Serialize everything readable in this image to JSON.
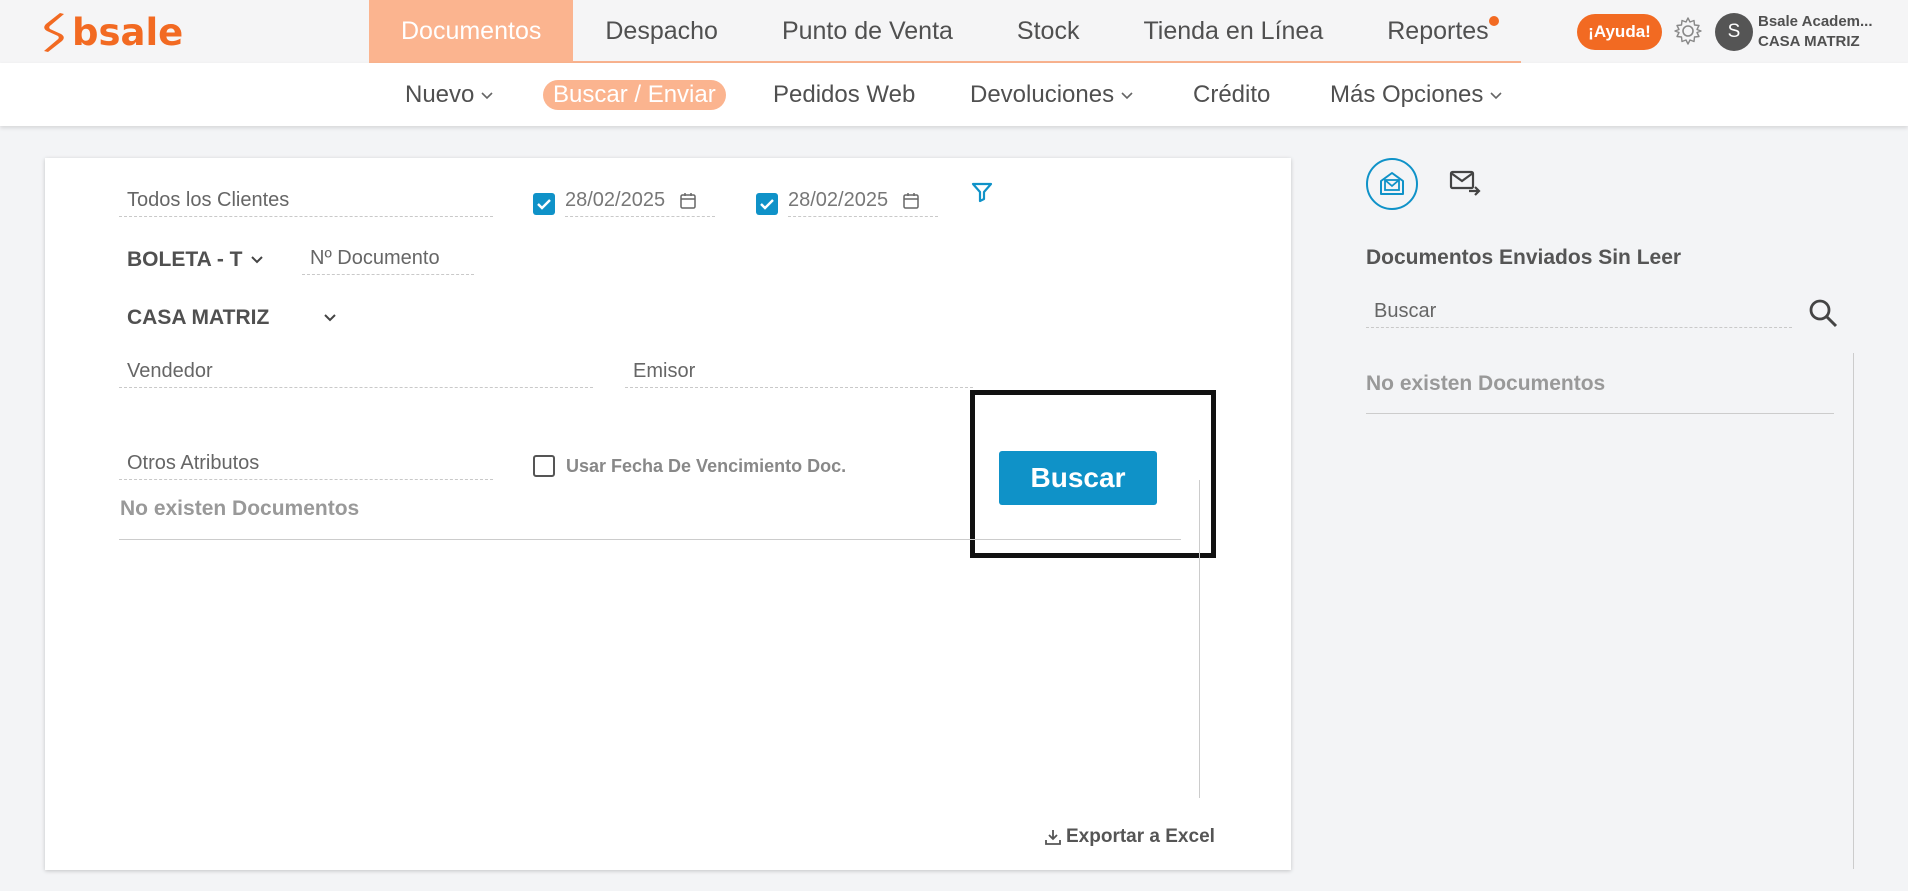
{
  "brand": {
    "name": "bsale",
    "color": "#f26a22"
  },
  "main_nav": [
    {
      "label": "Documentos",
      "active": true
    },
    {
      "label": "Despacho",
      "active": false
    },
    {
      "label": "Punto de Venta",
      "active": false
    },
    {
      "label": "Stock",
      "active": false
    },
    {
      "label": "Tienda en Línea",
      "active": false
    },
    {
      "label": "Reportes",
      "active": false,
      "notification_dot": true
    }
  ],
  "header": {
    "help_label": "¡Ayuda!",
    "avatar_initial": "S",
    "user_name": "Bsale Academ...",
    "user_branch": "CASA MATRIZ"
  },
  "sub_nav": {
    "nuevo": "Nuevo",
    "buscar_enviar": "Buscar / Enviar",
    "pedidos_web": "Pedidos Web",
    "devoluciones": "Devoluciones",
    "credito": "Crédito",
    "mas_opciones": "Más Opciones"
  },
  "filters": {
    "clients_placeholder": "Todos los Clientes",
    "date_from": "28/02/2025",
    "date_from_checked": true,
    "date_to": "28/02/2025",
    "date_to_checked": true,
    "doc_type": "BOLETA - T",
    "doc_number_placeholder": "Nº Documento",
    "branch": "CASA MATRIZ",
    "seller_placeholder": "Vendedor",
    "issuer_placeholder": "Emisor",
    "other_attributes_placeholder": "Otros Atributos",
    "use_due_date_label": "Usar Fecha De Vencimiento Doc.",
    "use_due_date_checked": false,
    "search_button": "Buscar"
  },
  "results": {
    "empty_message": "No existen Documentos",
    "export_label": "Exportar a Excel"
  },
  "sidebar": {
    "title": "Documentos Enviados Sin Leer",
    "search_placeholder": "Buscar",
    "empty_message": "No existen Documentos"
  },
  "colors": {
    "accent_orange": "#f26a22",
    "nav_active": "#fbb48f",
    "primary_blue": "#0f92c8"
  }
}
